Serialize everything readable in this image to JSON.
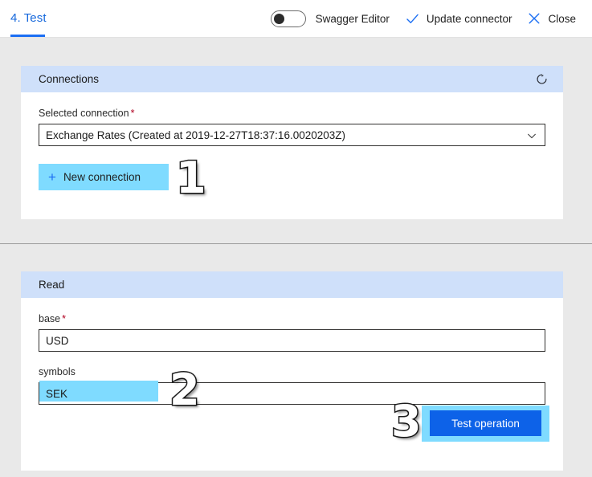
{
  "header": {
    "tab_label": "4. Test",
    "toggle": {
      "name": "swagger-editor-toggle",
      "label": "Swagger Editor",
      "state": "off"
    },
    "commands": [
      {
        "icon": "check-icon",
        "label": "Update connector"
      },
      {
        "icon": "close-icon",
        "label": "Close"
      }
    ]
  },
  "connections": {
    "title": "Connections",
    "refresh_icon": "refresh-icon",
    "selected_connection": {
      "label": "Selected connection",
      "required": "*",
      "value": "Exchange Rates (Created at 2019-12-27T18:37:16.0020203Z)",
      "chevron_icon": "chevron-down-icon"
    },
    "new_connection_button": {
      "label": "New connection",
      "icon": "plus-icon"
    }
  },
  "read": {
    "title": "Read",
    "fields": [
      {
        "label": "base",
        "required": "*",
        "value": "USD"
      },
      {
        "label": "symbols",
        "required": "",
        "value": "SEK"
      }
    ],
    "test_button_label": "Test operation"
  },
  "annotations": {
    "steps": [
      {
        "number": "1",
        "target": "new-connection-button"
      },
      {
        "number": "2",
        "target": "symbols-input"
      },
      {
        "number": "3",
        "target": "test-operation-button"
      }
    ]
  },
  "colors": {
    "accent_blue": "#1b6ef3",
    "primary_button": "#0d62e8",
    "card_header": "#cfe0fa",
    "highlight_cyan": "#7fdbff",
    "page_background": "#e9e9e9",
    "required_asterisk": "#b00020"
  }
}
